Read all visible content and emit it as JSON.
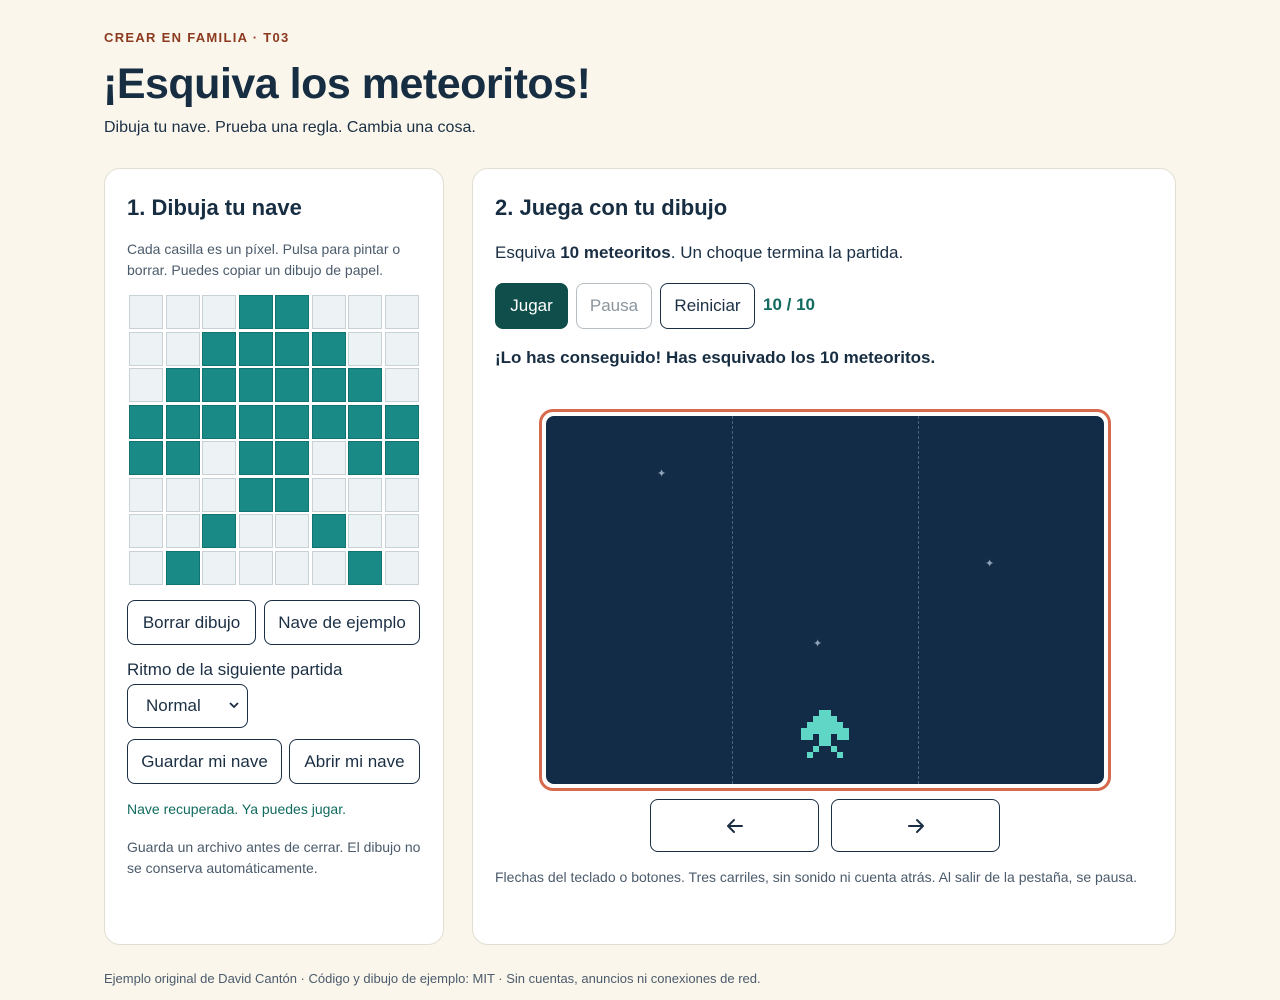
{
  "header": {
    "eyebrow": "CREAR EN FAMILIA · T03",
    "title": "¡Esquiva los meteoritos!",
    "subtitle": "Dibuja tu nave. Prueba una regla. Cambia una cosa."
  },
  "draw_panel": {
    "heading": "1. Dibuja tu nave",
    "hint": "Cada casilla es un píxel. Pulsa para pintar o borrar. Puedes copiar un dibujo de papel.",
    "grid": [
      [
        0,
        0,
        0,
        1,
        1,
        0,
        0,
        0
      ],
      [
        0,
        0,
        1,
        1,
        1,
        1,
        0,
        0
      ],
      [
        0,
        1,
        1,
        1,
        1,
        1,
        1,
        0
      ],
      [
        1,
        1,
        1,
        1,
        1,
        1,
        1,
        1
      ],
      [
        1,
        1,
        0,
        1,
        1,
        0,
        1,
        1
      ],
      [
        0,
        0,
        0,
        1,
        1,
        0,
        0,
        0
      ],
      [
        0,
        0,
        1,
        0,
        0,
        1,
        0,
        0
      ],
      [
        0,
        1,
        0,
        0,
        0,
        0,
        1,
        0
      ]
    ],
    "clear_label": "Borrar dibujo",
    "example_label": "Nave de ejemplo",
    "speed_label": "Ritmo de la siguiente partida",
    "speed_value": "Normal",
    "save_label": "Guardar mi nave",
    "open_label": "Abrir mi nave",
    "status": "Nave recuperada. Ya puedes jugar.",
    "note": "Guarda un archivo antes de cerrar. El dibujo no se conserva automáticamente."
  },
  "play_panel": {
    "heading": "2. Juega con tu dibujo",
    "desc_prefix": "Esquiva ",
    "desc_bold": "10 meteoritos",
    "desc_suffix": ". Un choque termina la partida.",
    "play_label": "Jugar",
    "pause_label": "Pausa",
    "restart_label": "Reiniciar",
    "score": "10 / 10",
    "result": "¡Lo has conseguido! Has esquivado los 10 meteoritos.",
    "game": {
      "lanes": 3,
      "ship_lane": "center",
      "background": "#122b47",
      "ship_color": "#5fd6c6",
      "frame_color": "#d7694d"
    },
    "left_icon": "arrow-left-icon",
    "right_icon": "arrow-right-icon",
    "help": "Flechas del teclado o botones. Tres carriles, sin sonido ni cuenta atrás. Al salir de la pestaña, se pausa."
  },
  "footer": "Ejemplo original de David Cantón · Código y dibujo de ejemplo: MIT · Sin cuentas, anuncios ni conexiones de red."
}
